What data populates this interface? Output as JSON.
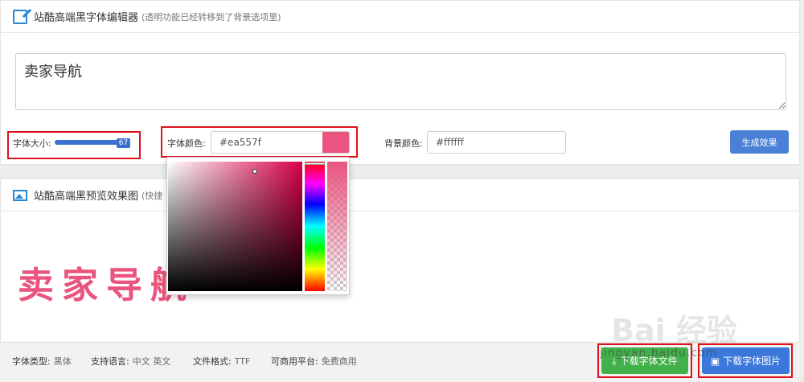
{
  "editor": {
    "title": "站酷高端黑字体编辑器",
    "subtitle": "(透明功能已经转移到了背景选项里)",
    "text_value": "卖家导航"
  },
  "controls": {
    "size_label": "字体大小:",
    "size_value": "67",
    "font_color_label": "字体颜色:",
    "font_color_value": "#ea557f",
    "bg_color_label": "背景颜色:",
    "bg_color_value": "#ffffff",
    "generate_label": "生成效果"
  },
  "colors": {
    "accent": "#4a80d5",
    "font_color": "#ea557f",
    "bg_color": "#ffffff",
    "highlight": "#e0101a",
    "download_file": "#43b14b",
    "download_image": "#3b78d9"
  },
  "preview": {
    "title": "站酷高端黑预览效果图",
    "subtitle": "(快捷",
    "text": "卖家导航"
  },
  "footer": {
    "type_label": "字体类型:",
    "type_value": "黑体",
    "lang_label": "支持语言:",
    "lang_value": "中文 英文",
    "format_label": "文件格式:",
    "format_value": "TTF",
    "commercial_label": "可商用平台:",
    "commercial_value": "免费商用",
    "download_file_label": "下载字体文件",
    "download_image_label": "下载字体图片"
  },
  "icons": {
    "editor": "edit-icon",
    "preview": "image-icon",
    "download_file": "download-icon",
    "download_image": "image-download-icon"
  },
  "watermark": {
    "logo": "Bai 经验",
    "site": "jingyan.baidu.com"
  }
}
